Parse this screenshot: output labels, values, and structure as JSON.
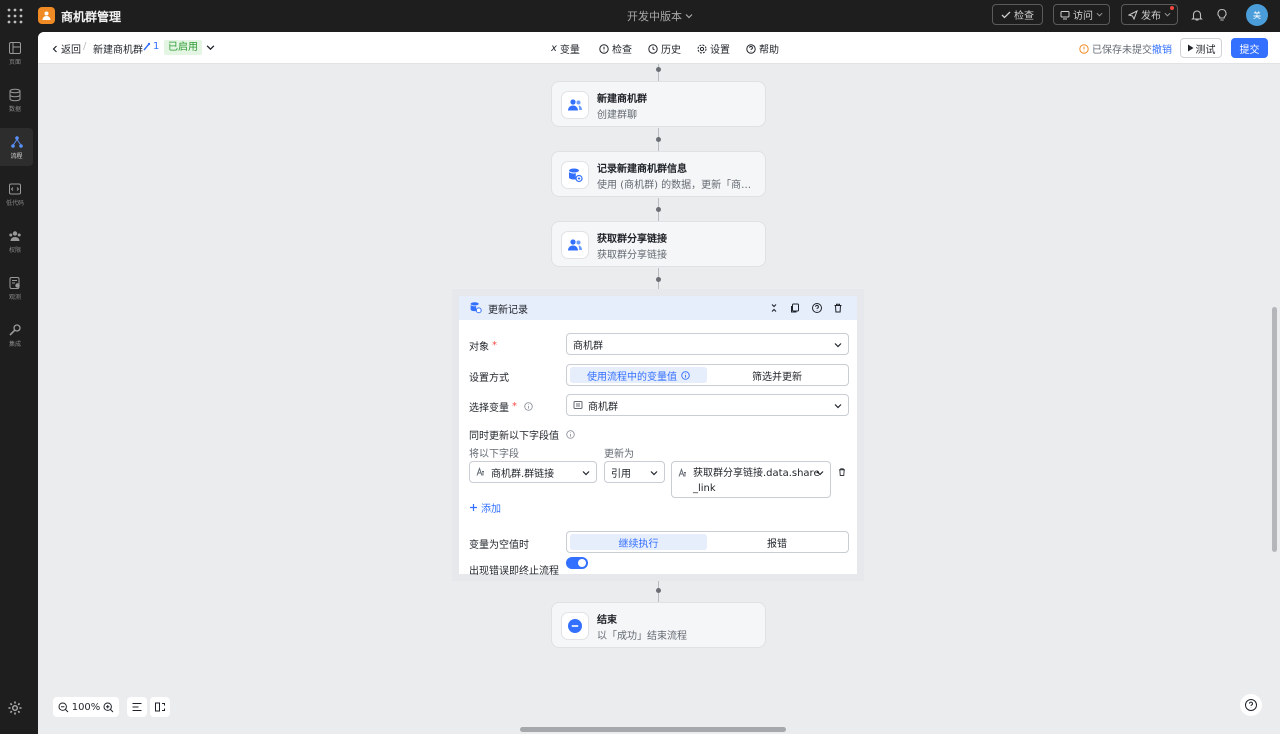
{
  "topbar": {
    "app_title": "商机群管理",
    "version": "开发中版本",
    "check_label": "检查",
    "visit_label": "访问",
    "publish_label": "发布",
    "avatar_text": "美"
  },
  "rail": {
    "items": [
      {
        "label": "页面",
        "icon": "pages-icon"
      },
      {
        "label": "数据",
        "icon": "database-icon"
      },
      {
        "label": "流程",
        "icon": "flow-icon",
        "active": true
      },
      {
        "label": "低代码",
        "icon": "code-icon"
      },
      {
        "label": "权限",
        "icon": "users-icon"
      },
      {
        "label": "观测",
        "icon": "observe-icon"
      },
      {
        "label": "集成",
        "icon": "integration-icon"
      }
    ]
  },
  "subbar": {
    "back_label": "返回",
    "flow_name": "新建商机群",
    "version_count": "1",
    "status": "已启用",
    "menu": {
      "variable": "变量",
      "check": "检查",
      "history": "历史",
      "settings": "设置",
      "help": "帮助"
    },
    "unsaved": "已保存未提交",
    "undo": "撤销",
    "test": "测试",
    "submit": "提交"
  },
  "nodes": [
    {
      "title": "新建商机群",
      "subtitle": "创建群聊",
      "icon": "group-users-icon"
    },
    {
      "title": "记录新建商机群信息",
      "subtitle": "使用 (商机群) 的数据，更新「商机群信息」",
      "icon": "db-update-icon"
    },
    {
      "title": "获取群分享链接",
      "subtitle": "获取群分享链接",
      "icon": "group-users-icon"
    },
    {
      "title": "结束",
      "subtitle": "以「成功」结束流程",
      "icon": "end-icon"
    }
  ],
  "panel": {
    "title": "更新记录",
    "object_label": "对象",
    "object_value": "商机群",
    "mode_label": "设置方式",
    "mode_option_a": "使用流程中的变量值",
    "mode_option_b": "筛选并更新",
    "var_label": "选择变量",
    "var_value": "商机群",
    "fields_label": "同时更新以下字段值",
    "col_field": "将以下字段",
    "col_update": "更新为",
    "field_value": "商机群.群链接",
    "ref_type": "引用",
    "ref_value_line1": "获取群分享链接.data.share",
    "ref_value_line2": "_link",
    "add_label": "添加",
    "empty_label": "变量为空值时",
    "empty_option_a": "继续执行",
    "empty_option_b": "报错",
    "stop_label": "出现错误即终止流程",
    "stop_enabled": true
  },
  "bottom": {
    "zoom": "100%"
  },
  "colors": {
    "accent": "#3370ff",
    "enabled_bg": "#e4f6e3",
    "enabled_text": "#2e9b35",
    "logo": "#f08a24"
  }
}
